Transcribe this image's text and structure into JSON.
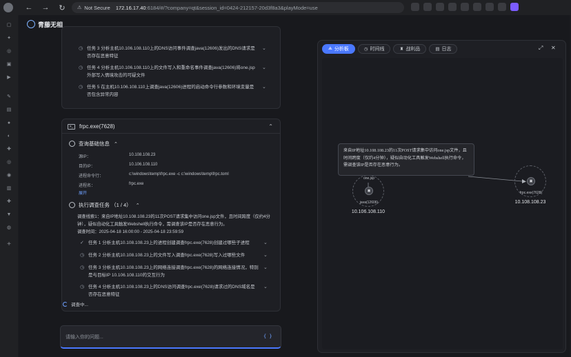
{
  "browser": {
    "security_label": "Not Secure",
    "url_host": "172.16.17.40",
    "url_rest": ":6184/#/?company=qt&session_id=0424-212157-20d3f8a3&playMode=use"
  },
  "app": {
    "name": "青藤无相"
  },
  "top_tasks": [
    {
      "text": "任务 3 分析主机10.106.108.110上的DNS访问事件调查java(12606)发出的DNS请求是否存在恶意特征"
    },
    {
      "text": "任务 4 分析主机10.106.108.110上的文件写入和重命名事件调查java(12606)将one.jsp外部写入情境攻击的可疑文件"
    },
    {
      "text": "任务 5 在主机10.106.108.110上调查java(12606)进程的启动命令行参数和环境变量是否包含异常内容"
    }
  ],
  "process_card": {
    "title": "frpc.exe(7628)",
    "basic_title": "查询基础信息",
    "fields": [
      {
        "k": "源IP：",
        "v": "10.108.108.23"
      },
      {
        "k": "目的IP：",
        "v": "10.106.108.110"
      },
      {
        "k": "进程命令行：",
        "v": "c:\\windows\\temp\\frpc.exe -c c:\\windows\\temp\\frpc.toml"
      },
      {
        "k": "进程名：",
        "v": "frpc.exe"
      }
    ],
    "expand_label": "展开",
    "exec_title": "执行调查任务 （1 / 4）",
    "clue": "调查线索1：来自IP地址10.108.108.23的11次POST请求集中访问one.jsp文件，且时间跨度（仅约4分钟），疑似自动化工具触发Webshell执行命令，需调查该IP是否存在恶意行为。",
    "time": "调查时间：2025-04-18 16:00:00 - 2025-04-18 23:59:59",
    "tasks": [
      {
        "text": "任务 1 分析主机10.108.108.23上的进程创建调查frpc.exe(7628)创建过哪些子进程",
        "done": true
      },
      {
        "text": "任务 2 分析主机10.108.108.23上的文件写入调查frpc.exe(7628)写入过哪些文件",
        "done": false
      },
      {
        "text": "任务 3 分析主机10.108.108.23上的网络连接调查frpc.exe(7628)的网络连接情况，特别是与目标IP 10.106.108.110的交互行为",
        "done": false
      },
      {
        "text": "任务 4 分析主机10.108.108.23上的DNS访问调查frpc.exe(7628)请求过的DNS域名是否存在恶意特征",
        "done": false
      }
    ]
  },
  "loading_label": "调查中...",
  "input": {
    "placeholder": "请输入你的问题..."
  },
  "panel": {
    "tabs": [
      {
        "label": "分析板",
        "active": true
      },
      {
        "label": "时间线",
        "active": false
      },
      {
        "label": "战利品",
        "active": false
      },
      {
        "label": "日志",
        "active": false
      }
    ],
    "tooltip": "来自IP地址10.108.108.23的11次POST请求集中访问one.jsp文件，且时间跨度（仅约4分钟），疑似自动化工具触发Webshell执行命令，需调查该IP是否存在恶意行为。",
    "nodes": [
      {
        "top_label": "one.jsp",
        "label": "java(12606)",
        "ip": "10.106.108.110"
      },
      {
        "top_label": "",
        "label": "frpc.exe(7628)",
        "ip": "10.108.108.23"
      }
    ]
  }
}
